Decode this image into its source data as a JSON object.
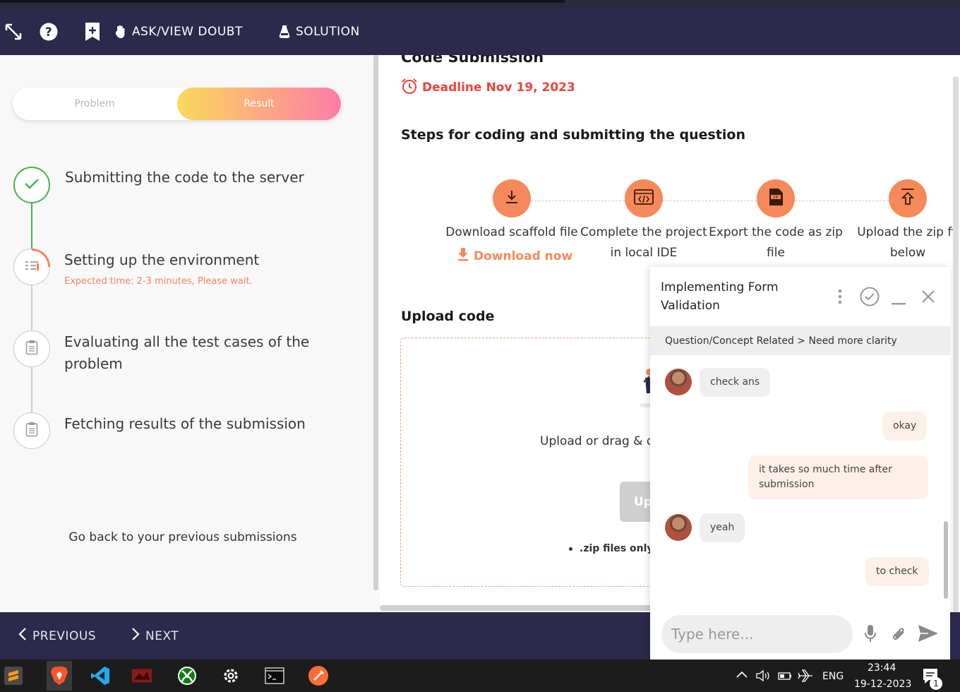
{
  "topbar": {
    "ask_label": "ASK/VIEW DOUBT",
    "solution_label": "SOLUTION"
  },
  "left": {
    "tab_problem": "Problem",
    "tab_result": "Result",
    "steps": [
      {
        "title": "Submitting the code to the server",
        "status": "done"
      },
      {
        "title": "Setting up the environment",
        "sub": "Expected time: 2-3 minutes, Please wait.",
        "status": "active"
      },
      {
        "title_line1": "Evaluating all the test cases of the",
        "title_line2": "problem",
        "status": "pending"
      },
      {
        "title": "Fetching results of the submission",
        "status": "pending"
      }
    ],
    "prev_submissions": "Go back to your previous submissions"
  },
  "right": {
    "section_title": "Code Submission",
    "deadline_label": "Deadline",
    "deadline_date": "Nov 19, 2023",
    "steps_heading": "Steps for coding and submitting the question",
    "steps": [
      {
        "line1": "Download scaffold file",
        "icon": "download-icon"
      },
      {
        "line1": "Complete the project",
        "line2": "in local IDE",
        "icon": "code-window-icon"
      },
      {
        "line1": "Export the code as zip",
        "line2": "file",
        "icon": "zip-file-icon"
      },
      {
        "line1": "Upload the zip fil",
        "line2": "below",
        "icon": "upload-icon"
      }
    ],
    "download_now": "Download now",
    "upload_heading": "Upload code",
    "upload_hint": "Upload or drag & d",
    "upload_button": "Up",
    "zip_note": ".zip files only"
  },
  "bottom": {
    "previous": "PREVIOUS",
    "next": "NEXT"
  },
  "chat": {
    "title_line1": "Implementing Form",
    "title_line2": "Validation",
    "category": "Question/Concept Related > Need more clarity",
    "messages": [
      {
        "from": "them",
        "text": "check ans"
      },
      {
        "from": "me",
        "text": "okay"
      },
      {
        "from": "me",
        "line1": "it takes so much time after",
        "line2": "submission"
      },
      {
        "from": "them",
        "text": "yeah"
      },
      {
        "from": "me",
        "text": "to check"
      }
    ],
    "input_placeholder": "Type here..."
  },
  "taskbar": {
    "lang": "ENG",
    "time": "23:44",
    "date": "19-12-2023",
    "notif_count": "1"
  },
  "colors": {
    "navbar": "#2b2a4c",
    "accent_orange": "#f5895a",
    "deadline_red": "#e8453c",
    "success_green": "#4caf50"
  }
}
